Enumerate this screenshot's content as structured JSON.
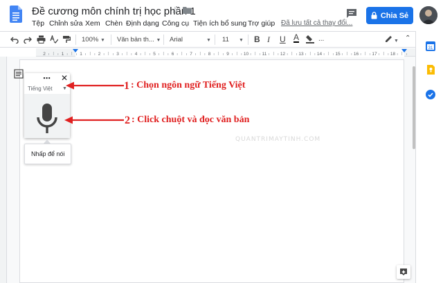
{
  "header": {
    "doc_title": "Đề cương môn chính trị học phần 1",
    "menu": [
      "Tệp",
      "Chỉnh sửa",
      "Xem",
      "Chèn",
      "Định dạng",
      "Công cụ",
      "Tiện ích bổ sung",
      "Trợ giúp"
    ],
    "saved_status": "Đã lưu tất cả thay đổi...",
    "share_label": "Chia Sẻ"
  },
  "toolbar": {
    "zoom": "100%",
    "style": "Văn bản th...",
    "font": "Arial",
    "font_size": "11",
    "ruler_numbers": [
      "2",
      "1",
      "1",
      "2",
      "3",
      "4",
      "5",
      "6",
      "7",
      "8",
      "9",
      "10",
      "11",
      "12",
      "13",
      "14",
      "15",
      "16",
      "17",
      "18"
    ]
  },
  "voice_typing": {
    "language": "Tiếng Việt",
    "tooltip": "Nhấp để nói"
  },
  "annotations": {
    "step1_number": "1",
    "step1_text": ": Chọn ngôn ngữ Tiếng Việt",
    "step2_number": "2",
    "step2_text": ": Click chuột và đọc văn bản"
  },
  "watermark": "QUANTRIMAYTINH.COM",
  "colors": {
    "share_blue": "#1a73e8",
    "annotation_red": "#e02020",
    "docs_blue": "#4285f4",
    "keep_yellow": "#fbbc04",
    "calendar_blue": "#1a73e8"
  }
}
